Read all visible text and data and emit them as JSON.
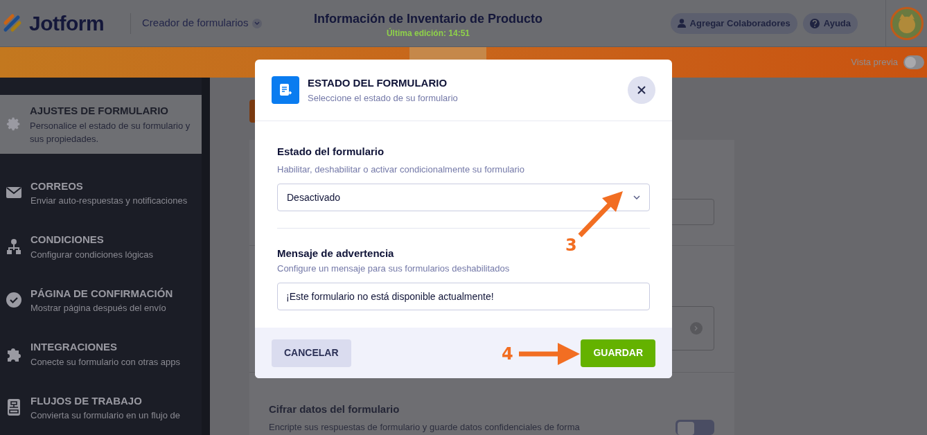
{
  "header": {
    "logo": "Jotform",
    "app_menu": "Creador de formularios",
    "title": "Información de Inventario de Producto",
    "last_edit": "Última edición: 14:51",
    "buttons": [
      {
        "kind": "person",
        "label": "Agregar Colaboradores"
      },
      {
        "kind": "help",
        "label": "Ayuda"
      }
    ]
  },
  "nav_tabs": [
    {
      "selected": false
    },
    {
      "selected": true
    },
    {
      "selected": false
    }
  ],
  "preview": {
    "label": "Vista previa",
    "on": false
  },
  "sidebar": {
    "items": [
      {
        "kind": "gear",
        "title": "AJUSTES DE FORMULARIO",
        "description": "Personalice el estado de su formulario y sus propiedades.",
        "selected": true
      },
      {
        "kind": "mail",
        "title": "CORREOS",
        "description": "Enviar auto-respuestas y notificaciones",
        "selected": false
      },
      {
        "kind": "tree",
        "title": "CONDICIONES",
        "description": "Configurar condiciones lógicas",
        "selected": false
      },
      {
        "kind": "check",
        "title": "PÁGINA DE CONFIRMACIÓN",
        "description": "Mostrar página después del envío",
        "selected": false
      },
      {
        "kind": "puzzle",
        "title": "INTEGRACIONES",
        "description": "Conecte su formulario con otras apps",
        "selected": false
      },
      {
        "kind": "flow",
        "title": "FLUJOS DE TRABAJO",
        "description": "Convierta su formulario en un flujo de",
        "selected": false
      }
    ]
  },
  "settings": {
    "encrypt": {
      "title": "Cifrar datos del formulario",
      "description": "Encripte sus respuestas de formulario y guarde datos confidenciales de forma",
      "on": false
    }
  },
  "dialog": {
    "title": "ESTADO DEL FORMULARIO",
    "subtitle": "Seleccione el estado de su formulario",
    "status": {
      "label": "Estado del formulario",
      "hint": "Habilitar, deshabilitar o activar condicionalmente su formulario",
      "value": "Desactivado"
    },
    "message": {
      "label": "Mensaje de advertencia",
      "hint": "Configure un mensaje para sus formularios deshabilitados",
      "value": "¡Este formulario no está disponible actualmente!"
    },
    "cancel": "CANCELAR",
    "save": "GUARDAR"
  },
  "annotations": [
    {
      "label": "3",
      "kind": "diagonal"
    },
    {
      "label": "4",
      "kind": "horizontal"
    }
  ]
}
